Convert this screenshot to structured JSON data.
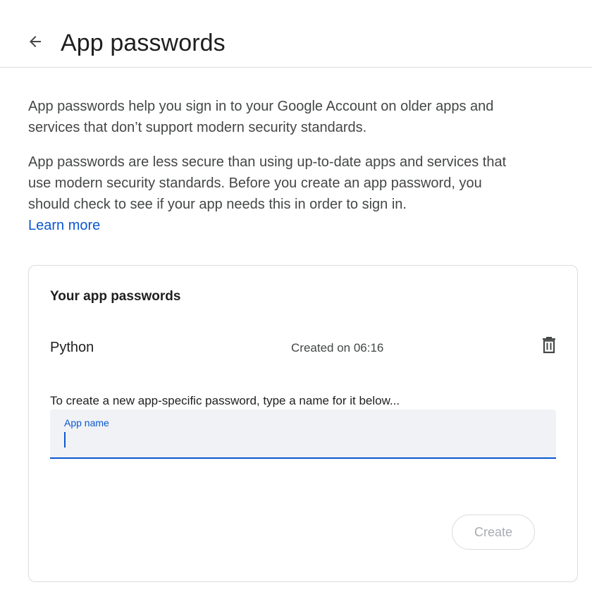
{
  "header": {
    "title": "App passwords",
    "back_icon": "arrow-back-icon"
  },
  "intro": {
    "paragraph1": "App passwords help you sign in to your Google Account on older apps and services that don’t support modern security standards.",
    "paragraph2": "App passwords are less secure than using up-to-date apps and services that use modern security standards. Before you create an app password, you should check to see if your app needs this in order to sign in.",
    "learn_more": "Learn more"
  },
  "card": {
    "title": "Your app passwords",
    "passwords": [
      {
        "name": "Python",
        "created": "Created on 06:16",
        "delete_icon": "trash-icon"
      }
    ],
    "instruction": "To create a new app-specific password, type a name for it below...",
    "field": {
      "label": "App name",
      "value": ""
    },
    "create_label": "Create"
  },
  "colors": {
    "accent": "#0b57d0",
    "text_primary": "#1f1f1f",
    "text_secondary": "#444746",
    "border": "#dadce0",
    "field_bg": "#f0f2f5",
    "disabled_text": "#a8abb0"
  }
}
